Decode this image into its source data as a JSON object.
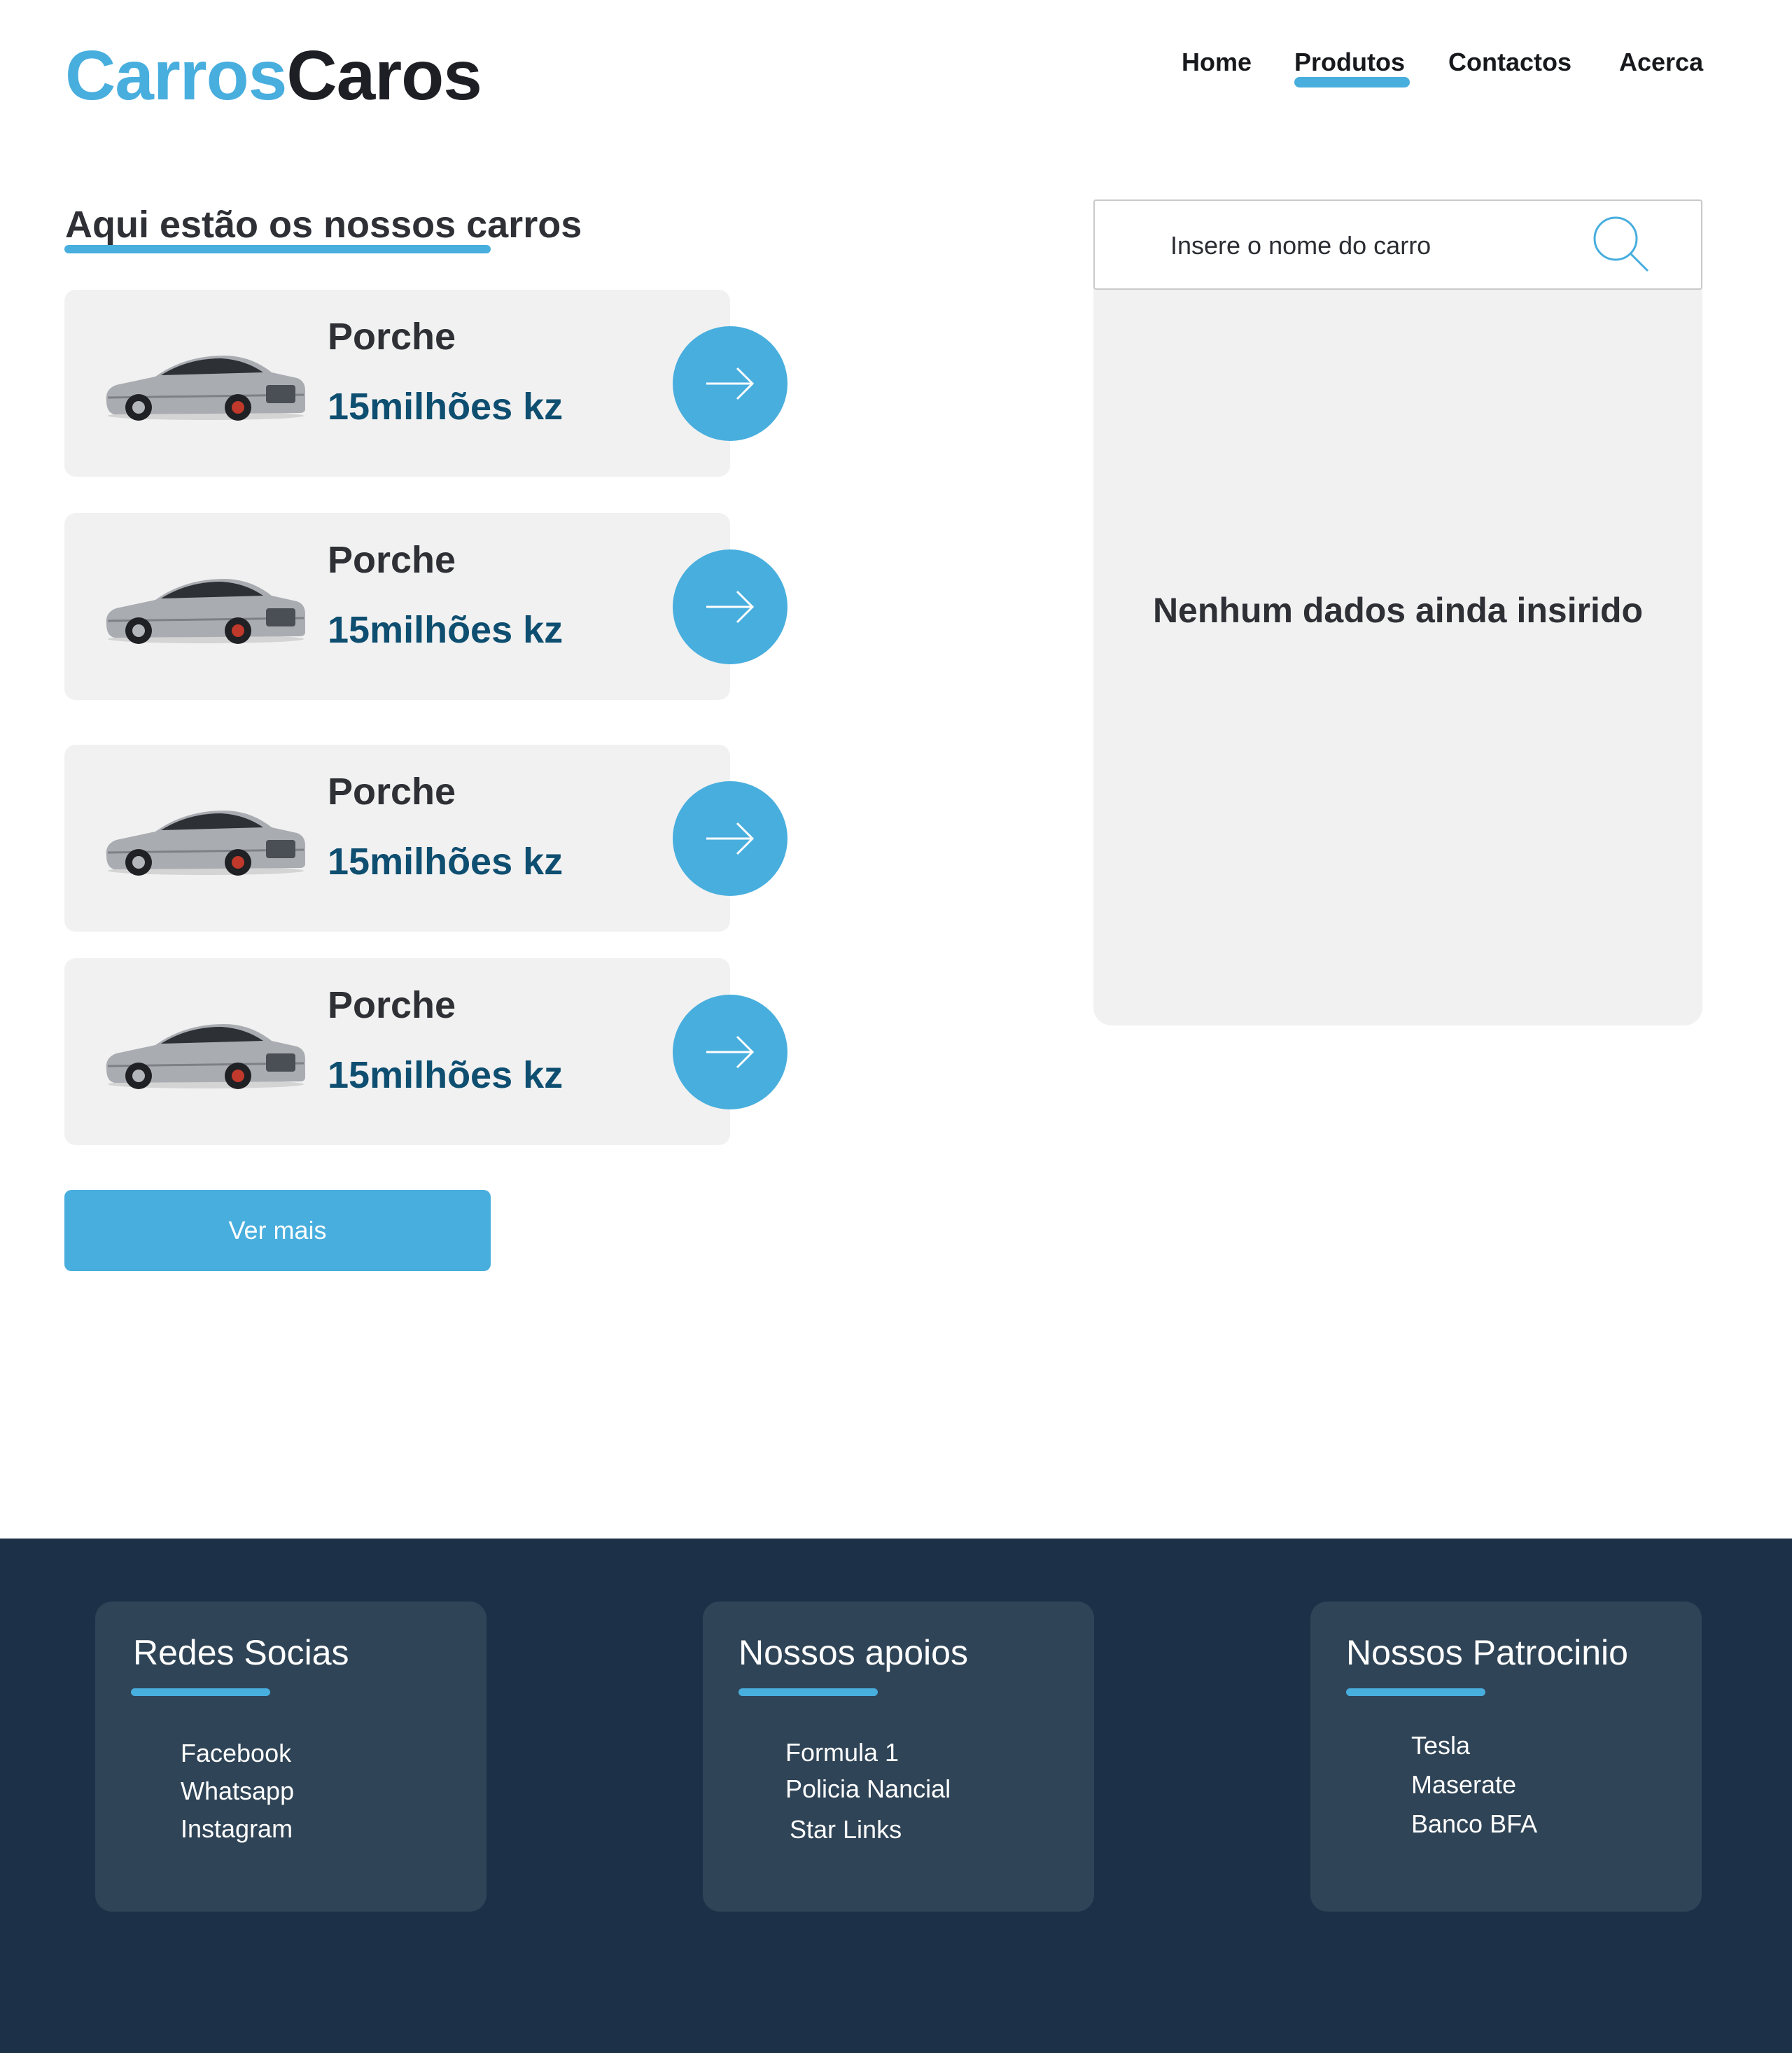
{
  "header": {
    "logo_part1": "Carros",
    "logo_part2": "Caros",
    "nav": [
      {
        "label": "Home"
      },
      {
        "label": "Produtos"
      },
      {
        "label": "Contactos"
      },
      {
        "label": "Acerca"
      }
    ],
    "active_nav": "Produtos"
  },
  "main": {
    "title": "Aqui estão os nossos carros",
    "cars": [
      {
        "name": "Porche",
        "price": "15milhões kz"
      },
      {
        "name": "Porche",
        "price": "15milhões kz"
      },
      {
        "name": "Porche",
        "price": "15milhões kz"
      },
      {
        "name": "Porche",
        "price": "15milhões kz"
      }
    ],
    "more_label": "Ver mais"
  },
  "search": {
    "placeholder": "Insere o nome do carro",
    "empty_message": "Nenhum dados ainda insirido"
  },
  "footer": {
    "columns": [
      {
        "title": "Redes Socias",
        "items": [
          "Facebook",
          "Whatsapp",
          "Instagram"
        ]
      },
      {
        "title": "Nossos apoios",
        "items": [
          "Formula 1",
          "Policia Nancial",
          "Star Links"
        ]
      },
      {
        "title": "Nossos Patrocinio",
        "items": [
          "Tesla",
          "Maserate",
          "Banco BFA"
        ]
      }
    ]
  },
  "colors": {
    "accent": "#48aede",
    "price": "#0e4e70",
    "footer_bg": "#1c3147",
    "footer_card": "#2f4456",
    "card_bg": "#f1f1f1"
  },
  "icons": {
    "arrow": "arrow-right-icon",
    "search": "magnifier-icon",
    "car": "car-image"
  }
}
